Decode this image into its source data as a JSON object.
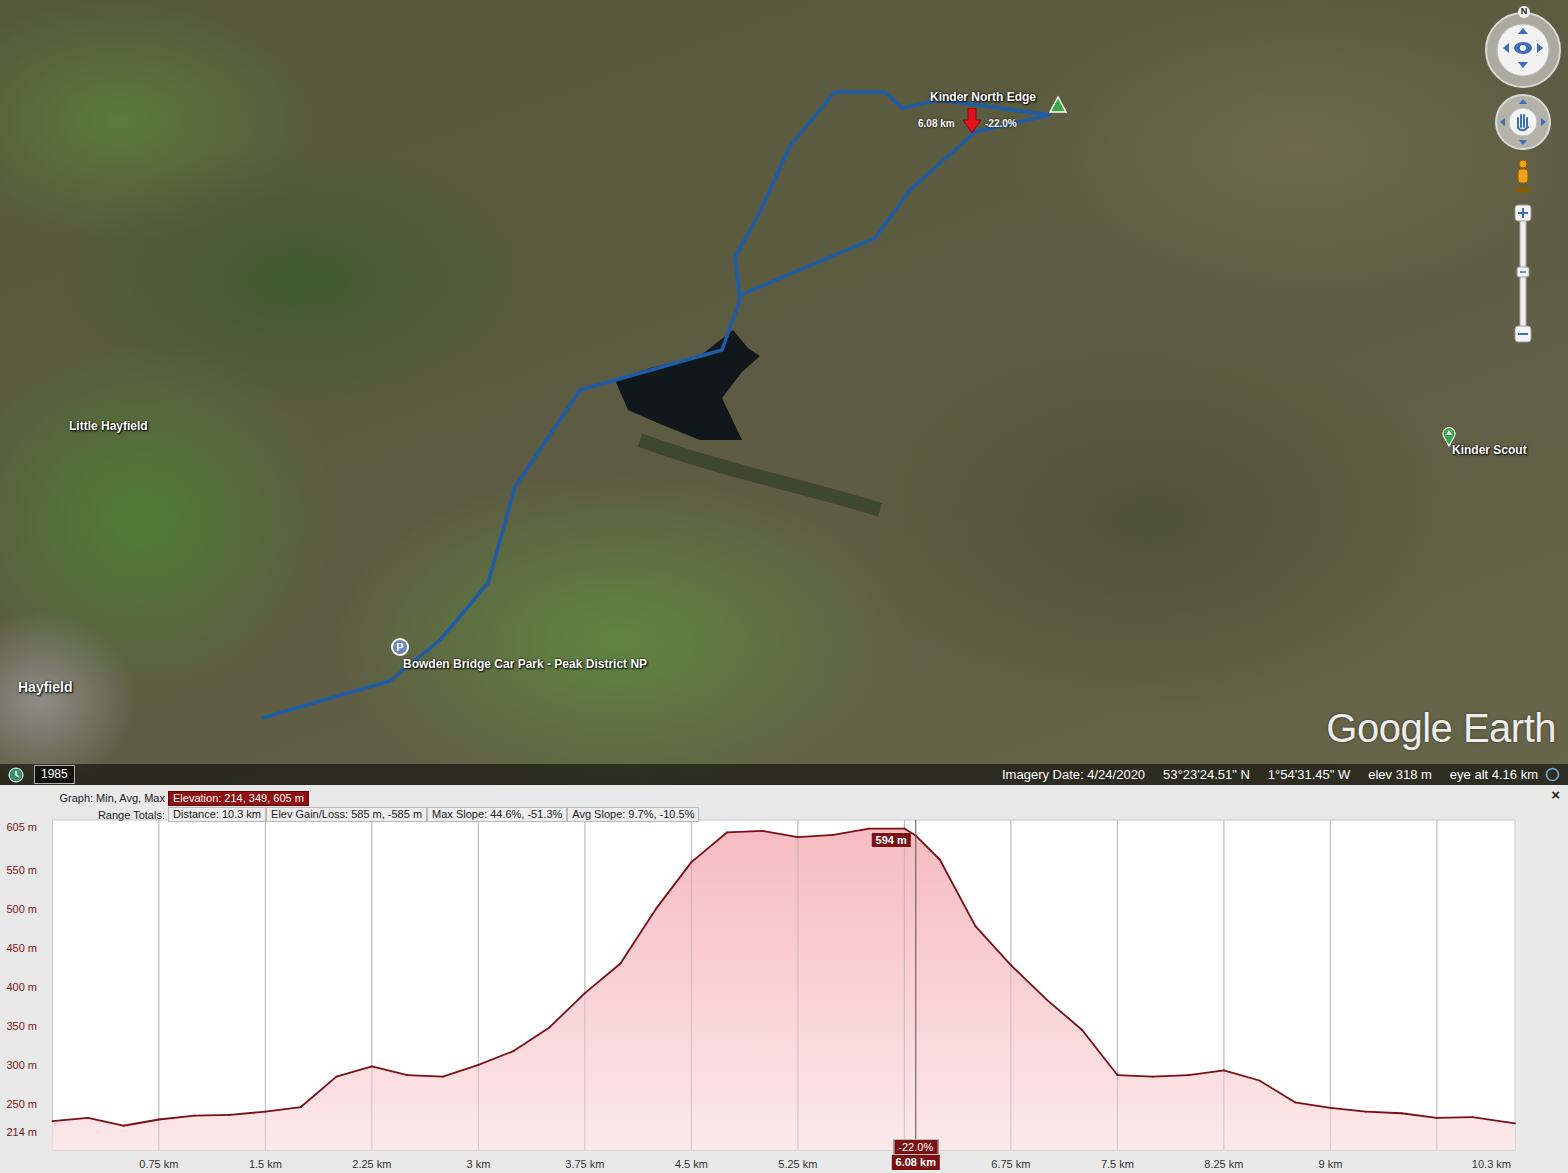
{
  "map": {
    "labels": [
      {
        "text": "Kinder North Edge",
        "kind": "summit"
      },
      {
        "text": "Little Hayfield",
        "kind": "place"
      },
      {
        "text": "Kinder Scout",
        "kind": "peak"
      },
      {
        "text": "Bowden Bridge Car Park - Peak District NP",
        "kind": "parking",
        "pin": "P"
      },
      {
        "text": "Hayfield",
        "kind": "town"
      }
    ],
    "marker": {
      "distance": "6.08 km",
      "slope": "-22.0%"
    },
    "watermark": "Google Earth",
    "compass": "N"
  },
  "status_bar": {
    "year": "1985",
    "imagery_date": "Imagery Date: 4/24/2020",
    "lat": "53°23'24.51\" N",
    "lon": "1°54'31.45\" W",
    "elev": "elev  318 m",
    "eye_alt": "eye alt  4.16 km"
  },
  "chart": {
    "graph_label": "Graph: Min, Avg, Max",
    "elevation": "Elevation: 214, 349, 605 m",
    "range_label": "Range Totals:",
    "totals": [
      "Distance: 10.3 km",
      "Elev Gain/Loss: 585 m, -585 m",
      "Max Slope: 44.6%, -51.3%",
      "Avg Slope: 9.7%, -10.5%"
    ],
    "close": "×",
    "y_ticks": [
      {
        "label": "605 m",
        "value": 605
      },
      {
        "label": "550 m",
        "value": 550
      },
      {
        "label": "500 m",
        "value": 500
      },
      {
        "label": "450 m",
        "value": 450
      },
      {
        "label": "400 m",
        "value": 400
      },
      {
        "label": "350 m",
        "value": 350
      },
      {
        "label": "300 m",
        "value": 300
      },
      {
        "label": "250 m",
        "value": 250
      },
      {
        "label": "214 m",
        "value": 214
      }
    ],
    "x_ticks": [
      {
        "label": "0.75 km",
        "value": 0.75
      },
      {
        "label": "1.5 km",
        "value": 1.5
      },
      {
        "label": "2.25 km",
        "value": 2.25
      },
      {
        "label": "3 km",
        "value": 3
      },
      {
        "label": "3.75 km",
        "value": 3.75
      },
      {
        "label": "4.5 km",
        "value": 4.5
      },
      {
        "label": "5.25 km",
        "value": 5.25
      },
      {
        "label": "6.75 km",
        "value": 6.75
      },
      {
        "label": "7.5 km",
        "value": 7.5
      },
      {
        "label": "8.25 km",
        "value": 8.25
      },
      {
        "label": "9 km",
        "value": 9
      },
      {
        "label": "10.3 km",
        "value": 10.3
      }
    ],
    "series": [
      {
        "distances_km": [
          0,
          0.25,
          0.5,
          0.75,
          1,
          1.25,
          1.5,
          1.75,
          2,
          2.25,
          2.5,
          2.75,
          3,
          3.25,
          3.5,
          3.75,
          4,
          4.25,
          4.5,
          4.75,
          5,
          5.25,
          5.5,
          5.75,
          6,
          6.08,
          6.25,
          6.5,
          6.75,
          7,
          7.25,
          7.5,
          7.75,
          8,
          8.25,
          8.5,
          8.75,
          9,
          9.25,
          9.5,
          9.75,
          10,
          10.3
        ],
        "values": [
          228,
          232,
          222,
          230,
          235,
          236,
          240,
          246,
          285,
          298,
          287,
          285,
          300,
          318,
          348,
          392,
          430,
          500,
          560,
          598,
          600,
          592,
          595,
          603,
          603,
          594,
          563,
          478,
          428,
          384,
          345,
          287,
          285,
          287,
          293,
          280,
          252,
          245,
          240,
          238,
          232,
          233,
          225
        ]
      }
    ],
    "cursor": {
      "km": 6.08,
      "elevation": "594 m",
      "slope": "-22.0%",
      "distance": "6.08 km"
    }
  }
}
